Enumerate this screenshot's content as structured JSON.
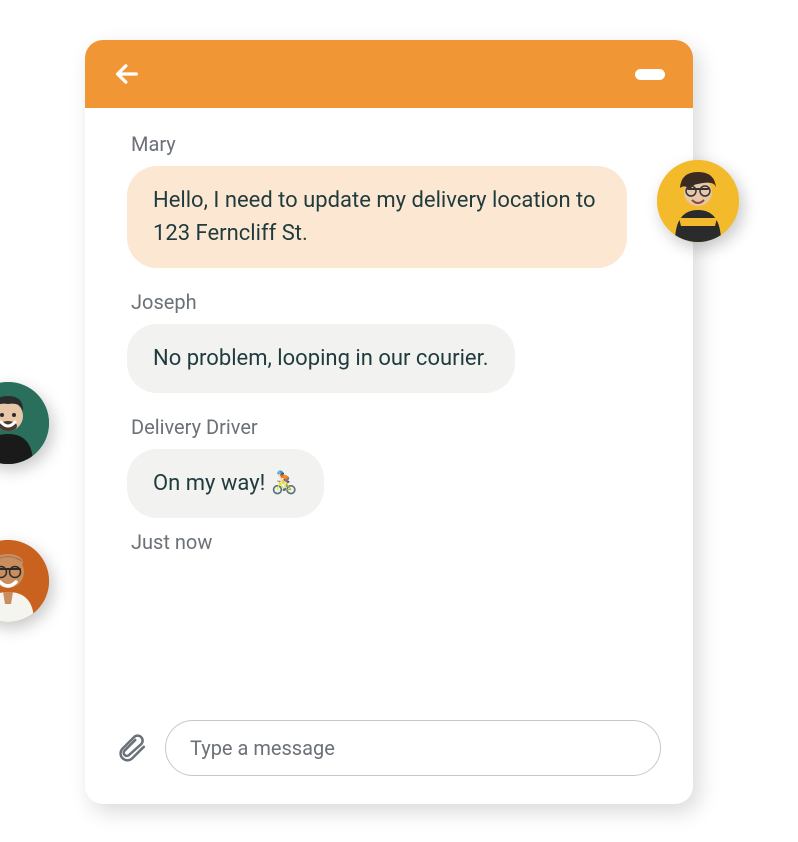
{
  "messages": [
    {
      "sender": "Mary",
      "text": "Hello, I need to update my delivery location to 123 Ferncliff St.",
      "role": "customer"
    },
    {
      "sender": "Joseph",
      "text": "No problem, looping in our courier.",
      "role": "agent"
    },
    {
      "sender": "Delivery Driver",
      "text": "On my way! 🚴🏻",
      "role": "driver"
    }
  ],
  "timestamp": "Just now",
  "input": {
    "placeholder": "Type a message"
  },
  "colors": {
    "header": "#f19635",
    "customer_bubble": "#fce8d2",
    "agent_bubble": "#f2f2f0"
  }
}
